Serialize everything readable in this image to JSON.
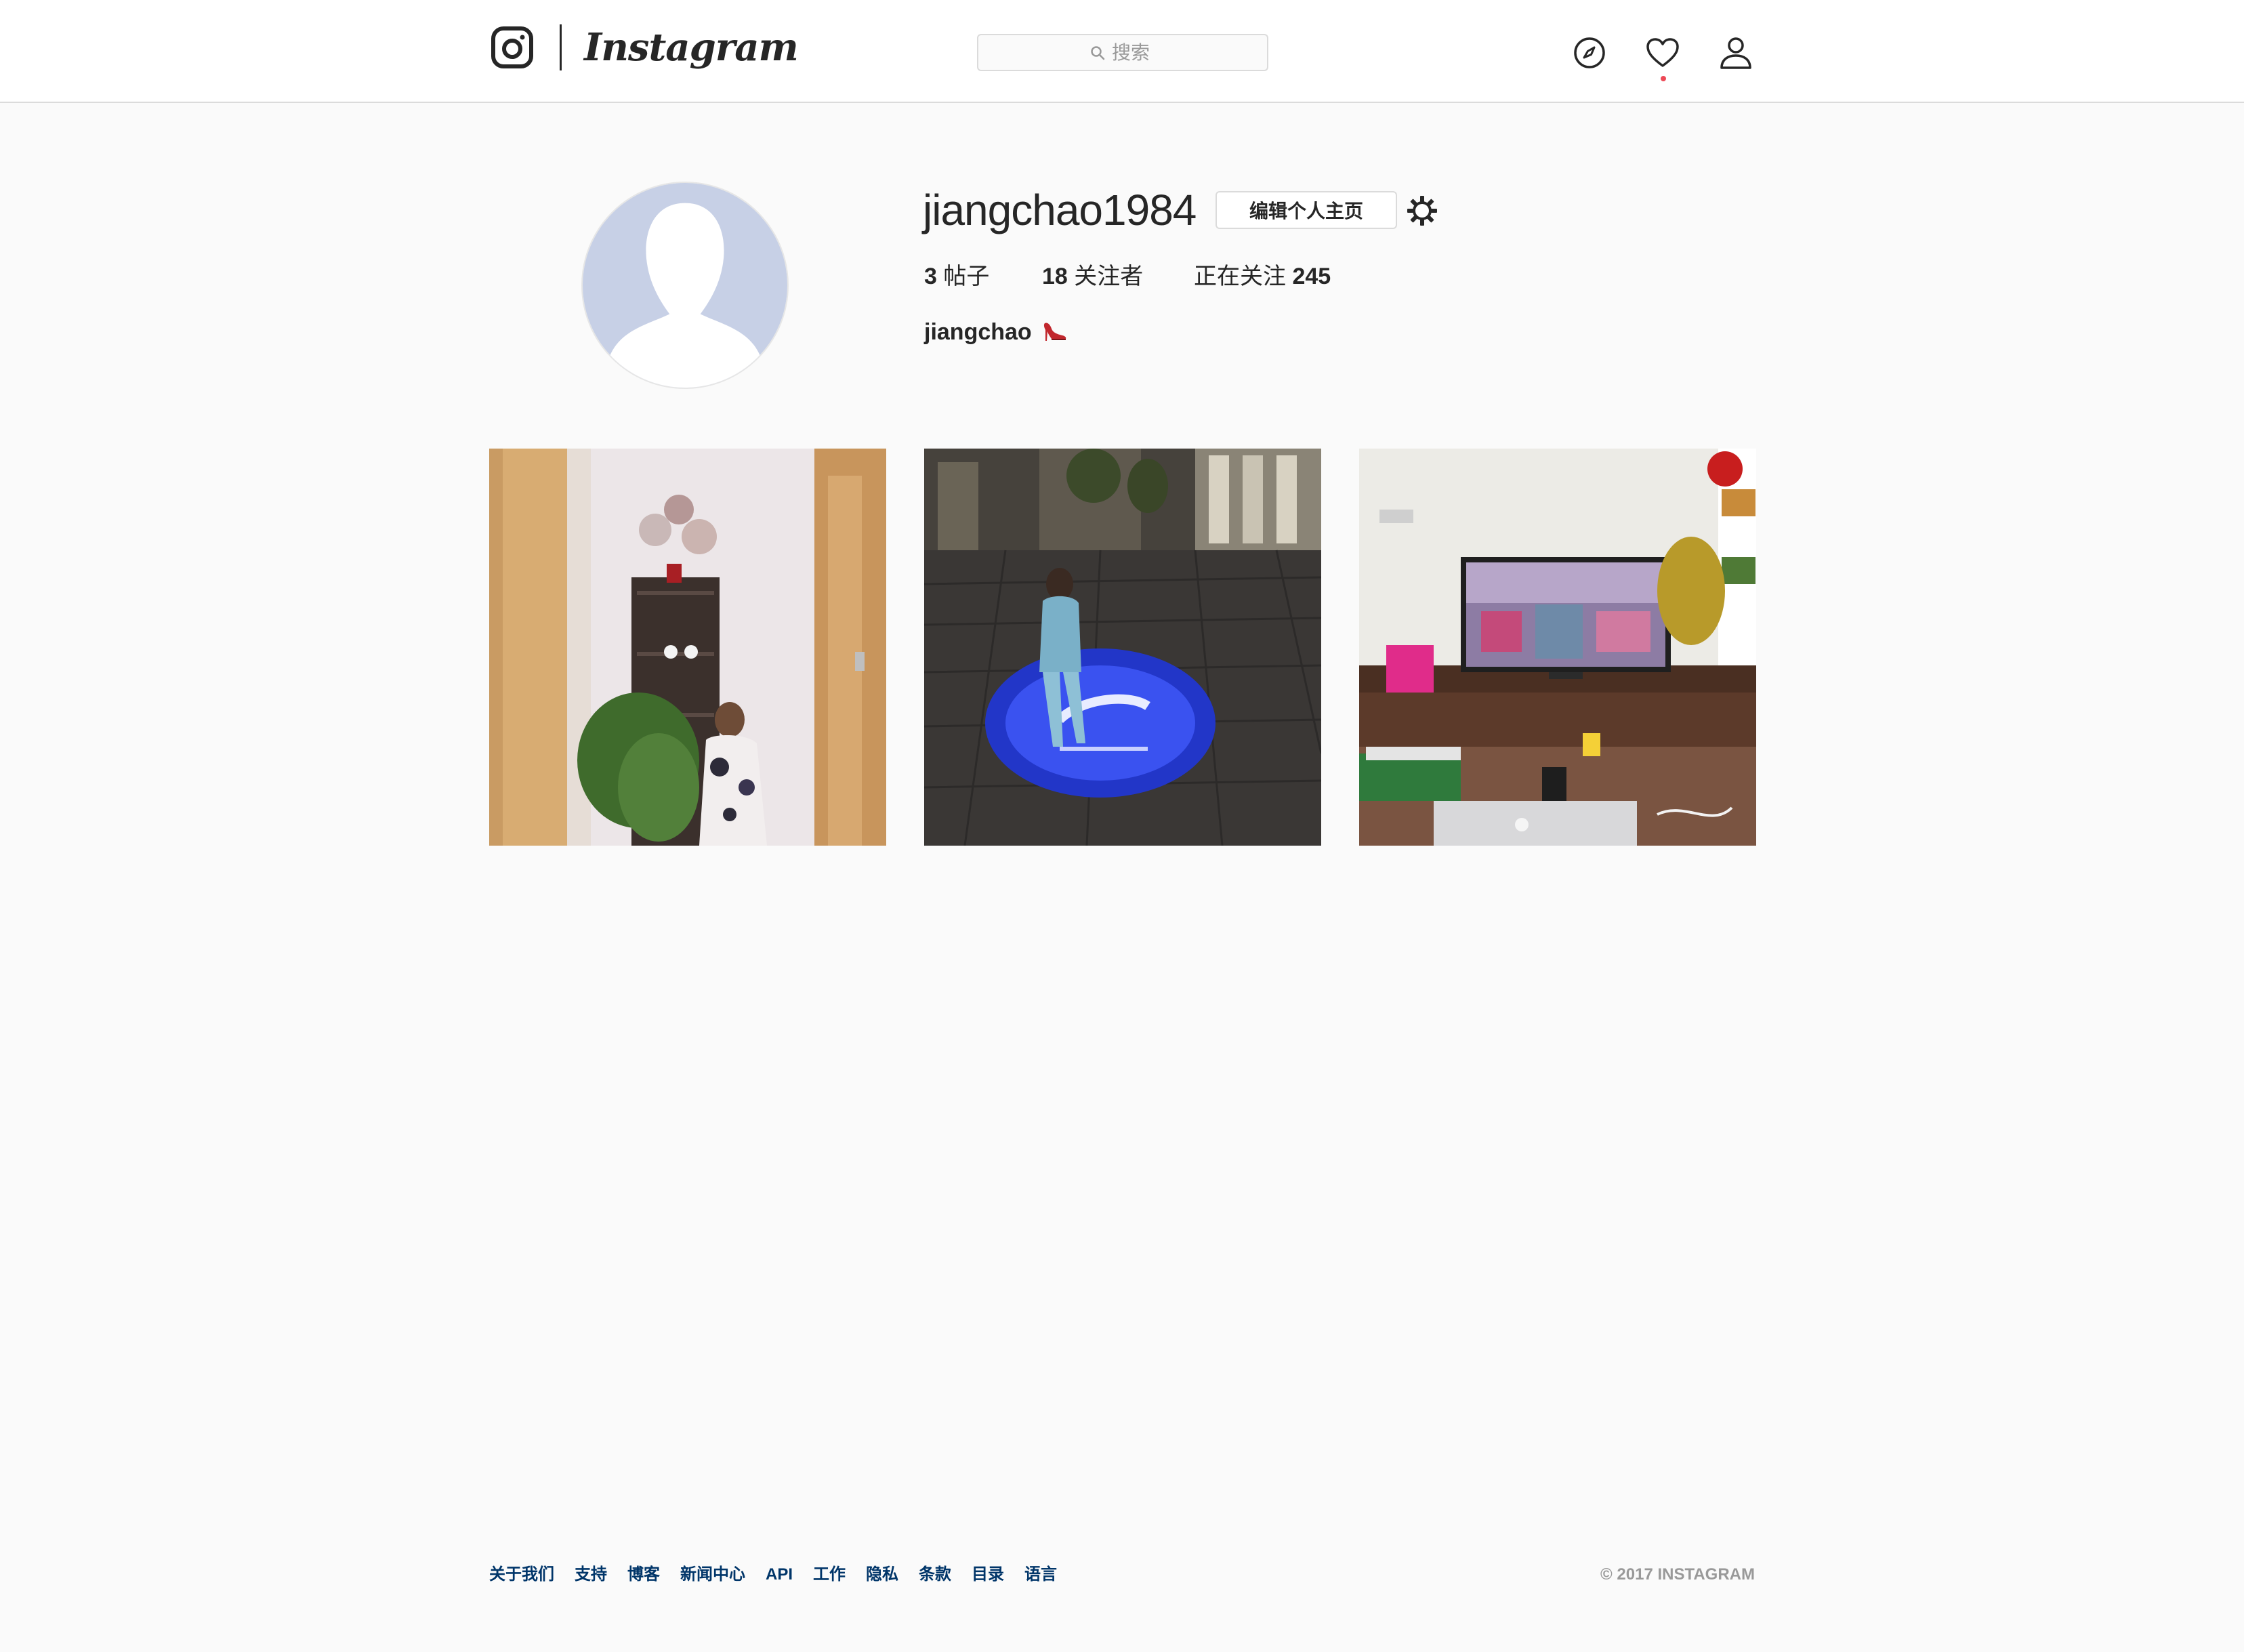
{
  "header": {
    "brand": "Instagram",
    "search_placeholder": "搜索",
    "icons": [
      "instagram-glyph-icon",
      "compass-icon",
      "heart-icon",
      "user-icon"
    ],
    "activity_dot_color": "#ed4956"
  },
  "profile": {
    "username": "jiangchao1984",
    "edit_label": "编辑个人主页",
    "posts_count": "3",
    "posts_label": "帖子",
    "followers_count": "18",
    "followers_label": "关注者",
    "following_label": "正在关注",
    "following_count": "245",
    "full_name": "jiangchao",
    "bio_emoji_icon": "high-heel-shoe-icon"
  },
  "posts": [
    {
      "icon": "photo-girl-hallway"
    },
    {
      "icon": "photo-girl-logo-projection"
    },
    {
      "icon": "photo-living-room-tv"
    }
  ],
  "footer": {
    "links": [
      "关于我们",
      "支持",
      "博客",
      "新闻中心",
      "API",
      "工作",
      "隐私",
      "条款",
      "目录",
      "语言"
    ],
    "copyright": "© 2017 INSTAGRAM"
  },
  "colors": {
    "background": "#fafafa",
    "link": "#003569",
    "muted": "#999999",
    "border": "#dbdbdb"
  }
}
